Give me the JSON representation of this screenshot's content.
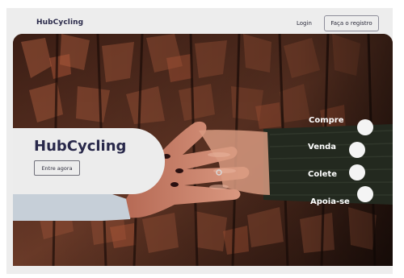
{
  "header": {
    "brand": "HubCycling",
    "login_label": "Login",
    "register_label": "Faça o registro"
  },
  "hero": {
    "title": "HubCycling",
    "cta_label": "Entre agora",
    "image_subject": "two hands clasped over tree bark",
    "menu": [
      {
        "label": "Compre"
      },
      {
        "label": "Venda"
      },
      {
        "label": "Colete"
      },
      {
        "label": "Apoia-se"
      }
    ]
  },
  "colors": {
    "page_bg": "#ededed",
    "brand_text": "#2a2a4a",
    "bark": "#5a3325",
    "menu_text": "#ffffff"
  }
}
